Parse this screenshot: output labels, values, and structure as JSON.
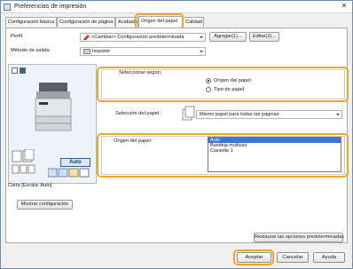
{
  "window": {
    "title": "Preferencias de impresión",
    "close_glyph": "✕"
  },
  "tabs": [
    {
      "label": "Configuración básica"
    },
    {
      "label": "Configuración de página"
    },
    {
      "label": "Acabado"
    },
    {
      "label": "Origen del papel",
      "active": true
    },
    {
      "label": "Calidad"
    }
  ],
  "profile": {
    "label": "Perfil:",
    "value": "<Cambiar> Configuración predeterminada",
    "add_button": "Agregar(1)...",
    "edit_button": "Editar(2)..."
  },
  "output": {
    "label": "Método de salida:",
    "value": "Imprimir"
  },
  "preview": {
    "caption": "Carta [Escala: Auto]",
    "auto_label": "Auto",
    "show_settings_button": "Mostrar configuración"
  },
  "select_by": {
    "group_label": "Seleccionar según:",
    "options": [
      {
        "label": "Origen del papel",
        "selected": true
      },
      {
        "label": "Tipo de papel",
        "selected": false
      }
    ]
  },
  "paper_selection": {
    "label": "Selección del papel:",
    "value": "Mismo papel para todas las páginas"
  },
  "paper_source": {
    "label": "Origen del papel:",
    "items": [
      "Auto",
      "Bandeja multiuso",
      "Cassette 1"
    ],
    "selected_index": 0
  },
  "restore_button": "Restaurar las opciones predeterminadas",
  "footer": {
    "ok": "Aceptar",
    "cancel": "Cancelar",
    "help": "Ayuda"
  },
  "colors": {
    "highlight": "#f0a626",
    "selection": "#3875d7"
  }
}
